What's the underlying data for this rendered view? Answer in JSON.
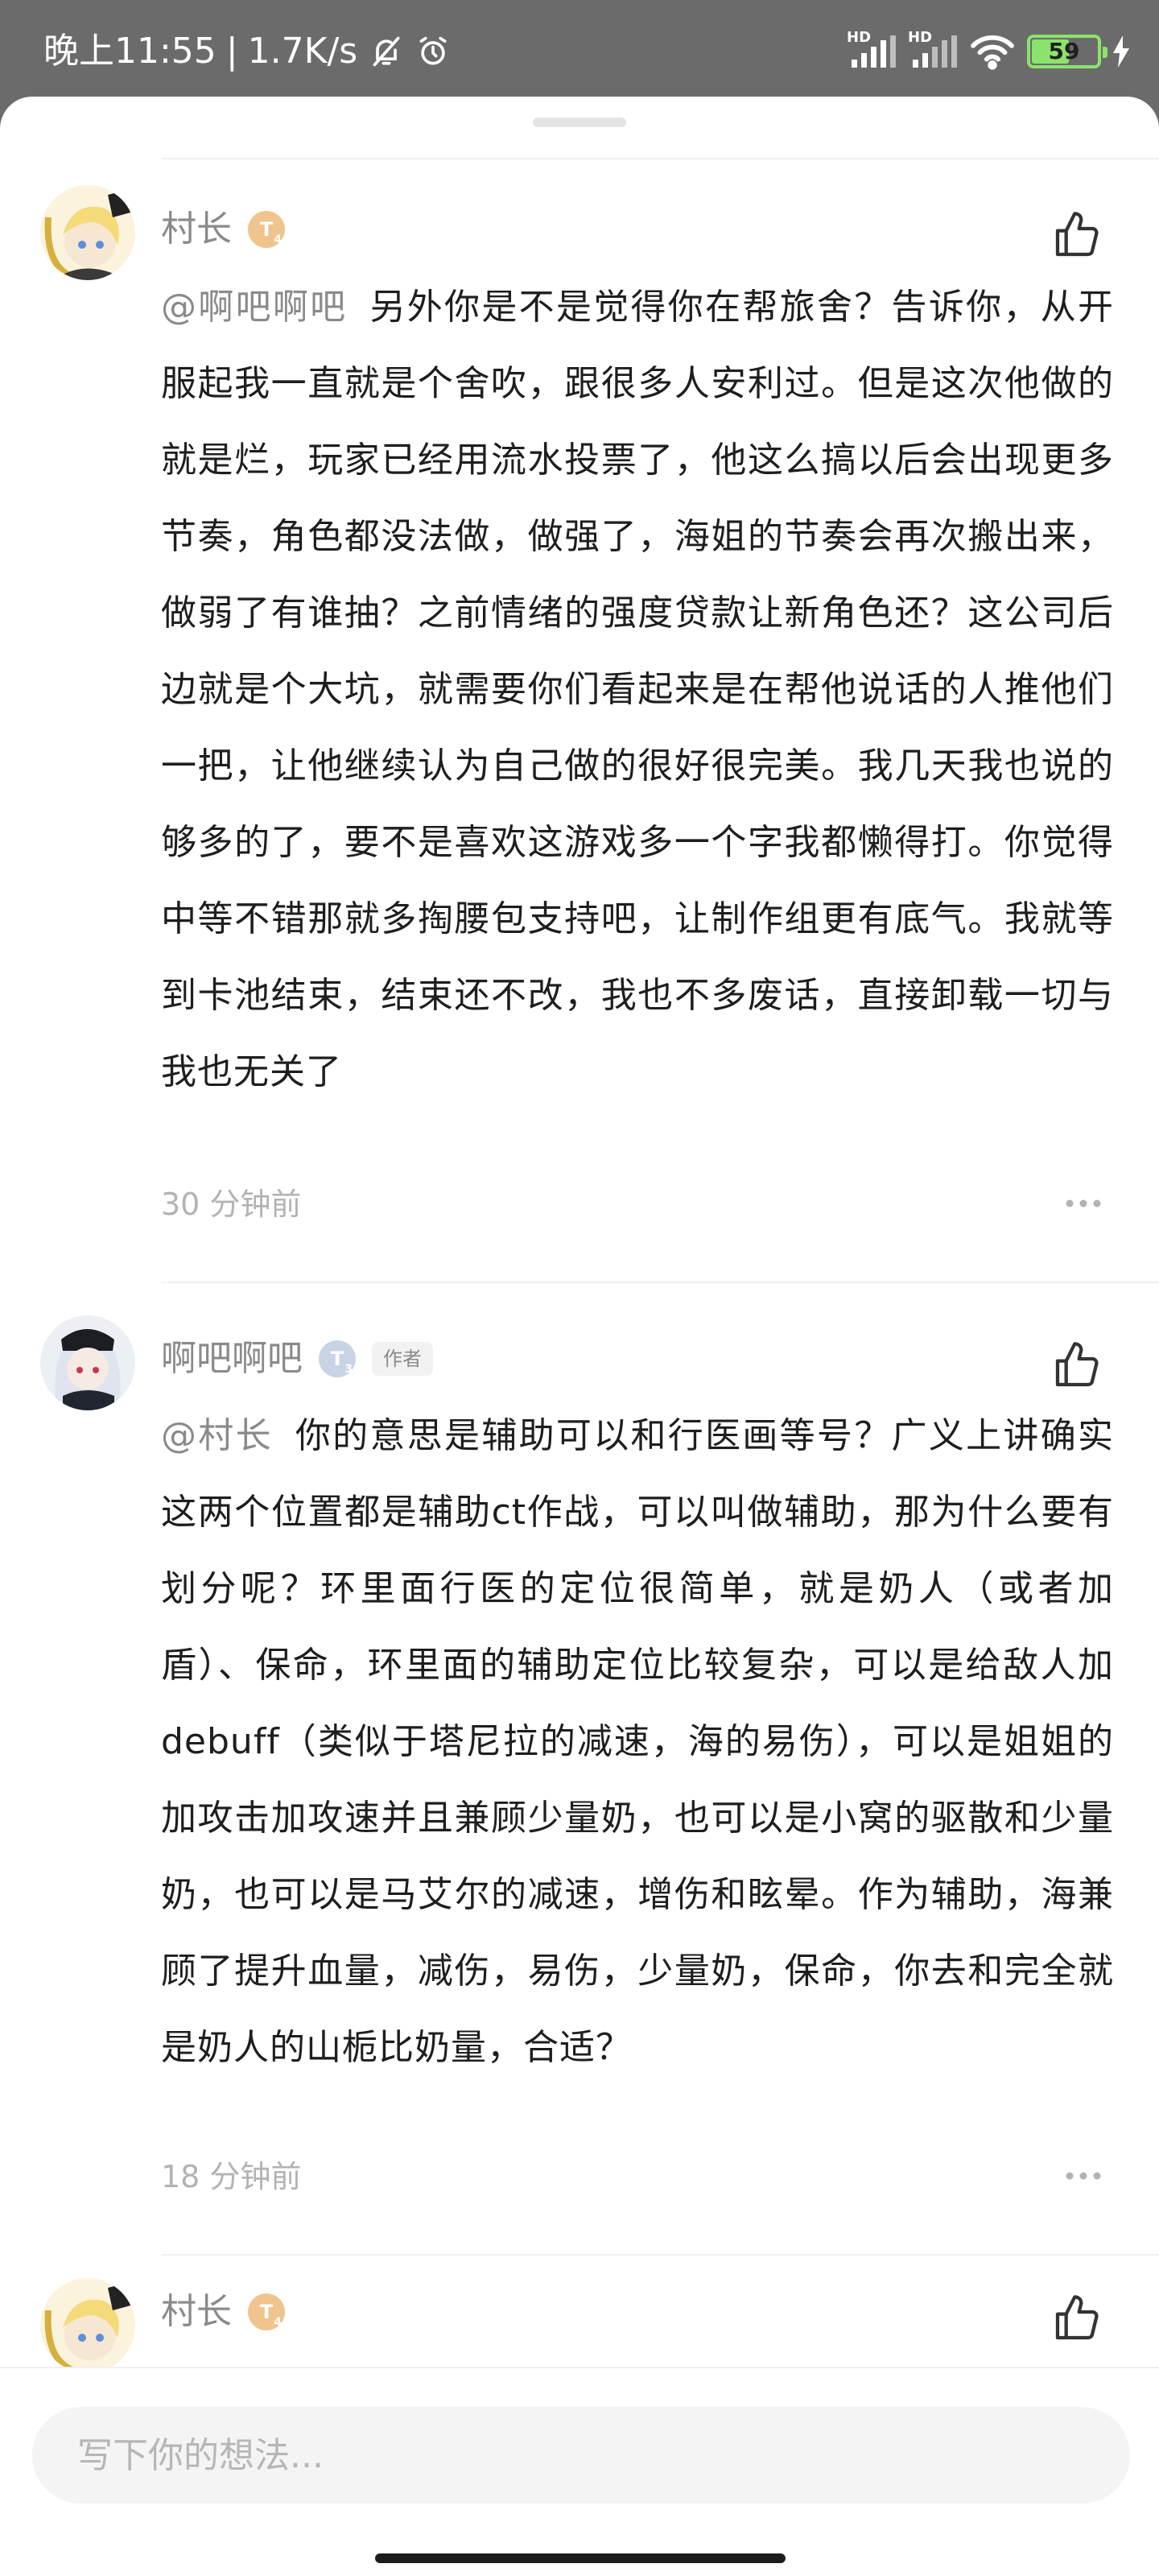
{
  "status_bar": {
    "time": "晚上11:55",
    "network_speed": "1.7K/s",
    "signal_1_label": "HD",
    "signal_2_label": "HD",
    "battery_percent": "59",
    "icons": [
      "bell-off-icon",
      "alarm-icon",
      "signal-icon",
      "wifi-icon",
      "battery-icon",
      "charging-icon"
    ]
  },
  "comments": [
    {
      "username": "村长",
      "level": "T",
      "level_sub": "4",
      "mention": "@啊吧啊吧",
      "text": "另外你是不是觉得你在帮旅舍？告诉你，从开服起我一直就是个舍吹，跟很多人安利过。但是这次他做的就是烂，玩家已经用流水投票了，他这么搞以后会出现更多节奏，角色都没法做，做强了，海姐的节奏会再次搬出来，做弱了有谁抽？之前情绪的强度贷款让新角色还？这公司后边就是个大坑，就需要你们看起来是在帮他说话的人推他们一把，让他继续认为自己做的很好很完美。我几天我也说的够多的了，要不是喜欢这游戏多一个字我都懒得打。你觉得中等不错那就多掏腰包支持吧，让制作组更有底气。我就等到卡池结束，结束还不改，我也不多废话，直接卸载一切与我也无关了",
      "time": "30 分钟前"
    },
    {
      "username": "啊吧啊吧",
      "level": "T",
      "level_sub": "3",
      "author_tag": "作者",
      "mention": "@村长",
      "text": "你的意思是辅助可以和行医画等号？广义上讲确实这两个位置都是辅助ct作战，可以叫做辅助，那为什么要有划分呢？环里面行医的定位很简单，就是奶人（或者加盾）、保命，环里面的辅助定位比较复杂，可以是给敌人加debuff（类似于塔尼拉的减速，海的易伤），可以是姐姐的加攻击加攻速并且兼顾少量奶，也可以是小窝的驱散和少量奶，也可以是马艾尔的减速，增伤和眩晕。作为辅助，海兼顾了提升血量，减伤，易伤，少量奶，保命，你去和完全就是奶人的山栀比奶量，合适？",
      "time": "18 分钟前"
    },
    {
      "username": "村长",
      "level": "T",
      "level_sub": "4"
    }
  ],
  "input": {
    "placeholder": "写下你的想法..."
  },
  "colors": {
    "status_bar_bg": "#6b6b6b",
    "username": "#8a8a8a",
    "body_text": "#1e1e1e",
    "timestamp": "#b3b3b3",
    "level_gold": "#f0c48d",
    "level_silver": "#c9d3e6",
    "battery": "#8be36b"
  }
}
